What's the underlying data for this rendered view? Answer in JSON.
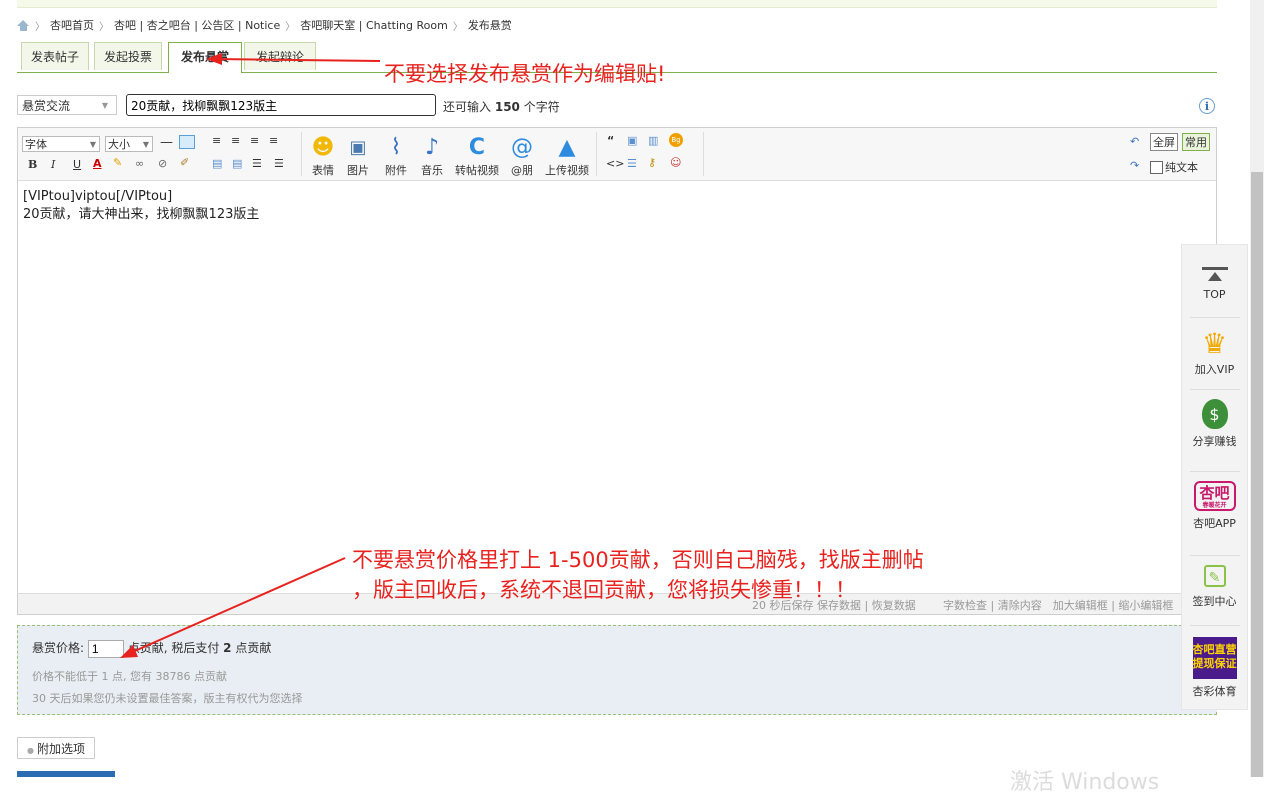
{
  "breadcrumb": {
    "items": [
      "杏吧首页",
      "杏吧 | 杏之吧台 | 公告区 | Notice",
      "杏吧聊天室 | Chatting Room",
      "发布悬赏"
    ],
    "separator": "〉"
  },
  "tabs": [
    "发表帖子",
    "发起投票",
    "发布悬赏",
    "发起辩论"
  ],
  "active_tab": "发布悬赏",
  "subject": {
    "type_value": "悬赏交流",
    "title_value": "20贡献，找柳飘飘123版主",
    "hint_prefix": "还可输入",
    "hint_count": "150",
    "hint_suffix": "个字符"
  },
  "toolbar": {
    "font_label": "字体",
    "size_label": "大小",
    "insert_labels": [
      "表情",
      "图片",
      "附件",
      "音乐",
      "转帖视频",
      "@朋",
      "上传视频"
    ],
    "fullscreen": "全屏",
    "common": "常用",
    "plaintext": "纯文本"
  },
  "editor": {
    "lines": [
      "[VIPtou]viptou[/VIPtou]",
      "20贡献，请大神出来，找柳飘飘123版主"
    ],
    "status_left": "20 秒后保存 保存数据 | 恢复数据",
    "status_right": "字数检查 | 清除内容　加大编辑框 | 缩小编辑框"
  },
  "reward": {
    "price_label": "悬赏价格:",
    "price_value": "1",
    "price_unit_pre": "点贡献, 税后支付",
    "price_tax": "2",
    "price_unit_post": "点贡献",
    "note1": "价格不能低于 1 点, 您有 38786 点贡献",
    "note2": "30 天后如果您仍未设置最佳答案，版主有权代为您选择"
  },
  "additional_options": "附加选项",
  "watermark": "激活 Windows",
  "float_bar": [
    {
      "icon": "top-icon",
      "label": "TOP"
    },
    {
      "icon": "crown-icon",
      "label": "加入VIP"
    },
    {
      "icon": "money-bag-icon",
      "label": "分享赚钱"
    },
    {
      "icon": "app-icon",
      "label": "杏吧APP",
      "badge": "杏吧",
      "sub": "春暖花开"
    },
    {
      "icon": "checkin-icon",
      "label": "签到中心"
    },
    {
      "icon": "sports-icon",
      "label": "杏彩体育",
      "badge1": "杏吧直营",
      "badge2": "提现保证"
    }
  ],
  "annotations": {
    "top": "不要选择发布悬赏作为编辑贴!",
    "bottom_line1": "不要悬赏价格里打上 1-500贡献，否则自己脑残，找版主删帖",
    "bottom_line2": "，版主回收后，系统不退回贡献，您将损失惨重！！！"
  },
  "colors": {
    "annotation_red": "#e8231f",
    "tab_border_green": "#7fb04a",
    "reward_bg": "#e8eef3"
  }
}
